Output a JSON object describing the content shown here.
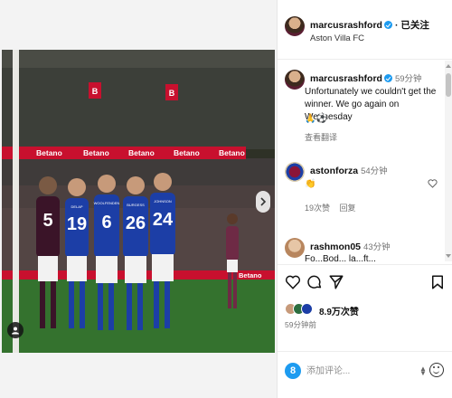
{
  "post": {
    "author": "marcusrashford",
    "follow_label": "· 已关注",
    "location": "Aston Villa FC",
    "image_alt": "Players lining up in a defensive wall at Villa Park",
    "photo_texts": {
      "board_brand": "Betano",
      "jerseys": [
        {
          "name": "",
          "number": "5"
        },
        {
          "name": "DELAP",
          "number": "19"
        },
        {
          "name": "WOOLFENDEN",
          "number": "6"
        },
        {
          "name": "BURGESS",
          "number": "26"
        },
        {
          "name": "JOHNSON",
          "number": "24"
        }
      ]
    }
  },
  "caption": {
    "username": "marcusrashford",
    "time": "59分钟",
    "text": "Unfortunately we couldn't get the winner. We go again on Wednesday",
    "emoji": "🙏⚽",
    "translate_label": "查看翻译"
  },
  "comments": [
    {
      "username": "astonforza",
      "time": "54分钟",
      "text": "👏",
      "likes": "19次赞",
      "reply_label": "回复"
    },
    {
      "username": "rashmon05",
      "time": "43分钟",
      "text": "Fo...Bod... la...ft..."
    }
  ],
  "actions": {
    "likes_text": "8.9万次赞",
    "post_time": "59分钟前"
  },
  "add_comment": {
    "placeholder": "添加评论..."
  },
  "icons": {
    "like": "heart-icon",
    "comment": "comment-icon",
    "share": "paper-plane-icon",
    "save": "bookmark-icon",
    "next": "chevron-right-icon",
    "tag": "user-tag-icon",
    "emoji": "smiley-icon"
  },
  "colors": {
    "verified": "#1d9bf0",
    "home_kit": "#3a1428",
    "away_kit": "#1c3ea6",
    "board_red": "#c8102e"
  }
}
